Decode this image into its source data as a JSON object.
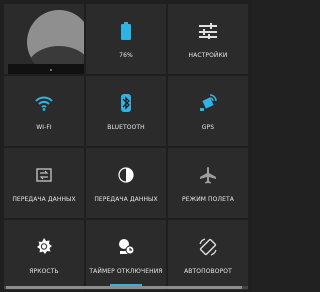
{
  "tiles": [
    {
      "key": "profile",
      "label": ""
    },
    {
      "key": "battery",
      "label": "76%"
    },
    {
      "key": "settings",
      "label": "НАСТРОЙКИ"
    },
    {
      "key": "wifi",
      "label": "WI-FI"
    },
    {
      "key": "bluetooth",
      "label": "BLUETOOTH"
    },
    {
      "key": "gps",
      "label": "GPS"
    },
    {
      "key": "data1",
      "label": "ПЕРЕДАЧА ДАННЫХ"
    },
    {
      "key": "data2",
      "label": "ПЕРЕДАЧА ДАННЫХ"
    },
    {
      "key": "airplane",
      "label": "РЕЖИМ ПОЛЕТА"
    },
    {
      "key": "brightness",
      "label": "ЯРКОСТЬ"
    },
    {
      "key": "sleep_timer",
      "label": "ТАЙМЕР ОТКЛЮЧЕНИЯ"
    },
    {
      "key": "autorotate",
      "label": "АВТОПОВОРОТ"
    }
  ],
  "colors": {
    "accent": "#2fb3e3",
    "tile_bg": "#2b2b2b",
    "icon_gray": "#e0e0e0"
  },
  "icons": {
    "battery": "battery-icon",
    "settings": "sliders-icon",
    "wifi": "wifi-icon",
    "bluetooth": "bluetooth-icon",
    "gps": "satellite-icon",
    "data1": "data-transfer-icon",
    "data2": "contrast-icon",
    "airplane": "airplane-icon",
    "brightness": "sun-icon",
    "sleep_timer": "sleep-timer-icon",
    "autorotate": "rotate-icon"
  }
}
